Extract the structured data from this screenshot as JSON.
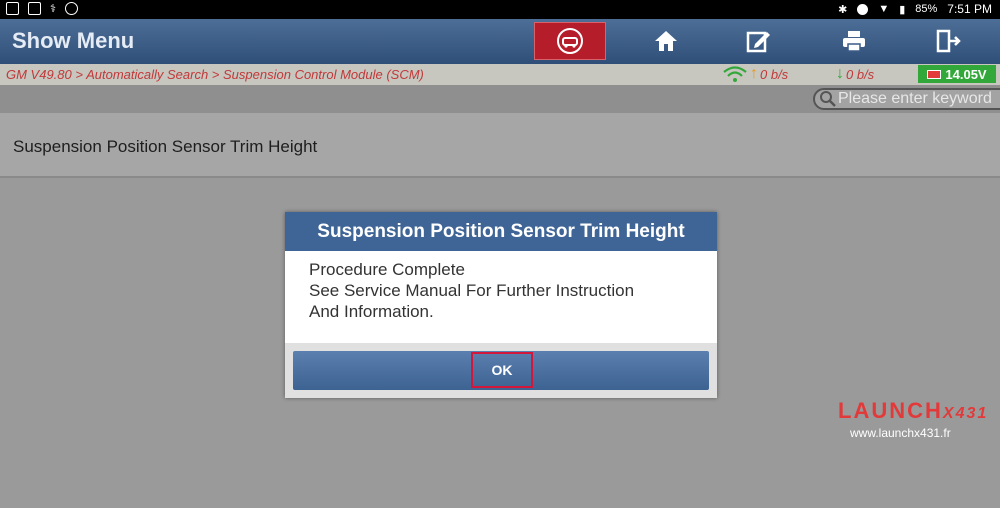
{
  "status_bar": {
    "battery": "85%",
    "time": "7:51 PM"
  },
  "header": {
    "title": "Show Menu",
    "toolbar": [
      "diagnose-icon",
      "home-icon",
      "edit-report-icon",
      "print-icon",
      "exit-icon"
    ]
  },
  "path_bar": {
    "breadcrumb": "GM V49.80 > Automatically Search > Suspension Control Module (SCM)",
    "upload_rate": "0 b/s",
    "download_rate": "0 b/s",
    "voltage": "14.05V"
  },
  "search": {
    "placeholder": "Please enter keyword"
  },
  "list": {
    "items": [
      "Suspension Position Sensor Trim Height"
    ]
  },
  "dialog": {
    "title": "Suspension Position Sensor Trim Height",
    "lines": [
      "Procedure Complete",
      "See Service Manual For Further Instruction",
      "And Information."
    ],
    "ok_label": "OK"
  },
  "watermark": {
    "brand": "LAUNCH",
    "brand_suffix": "X431",
    "url": "www.launchx431.fr"
  },
  "colors": {
    "header": "#3a5c87",
    "diag_button": "#b51d2b",
    "voltage_badge": "#33a83a",
    "ok_highlight": "#d3163a"
  }
}
